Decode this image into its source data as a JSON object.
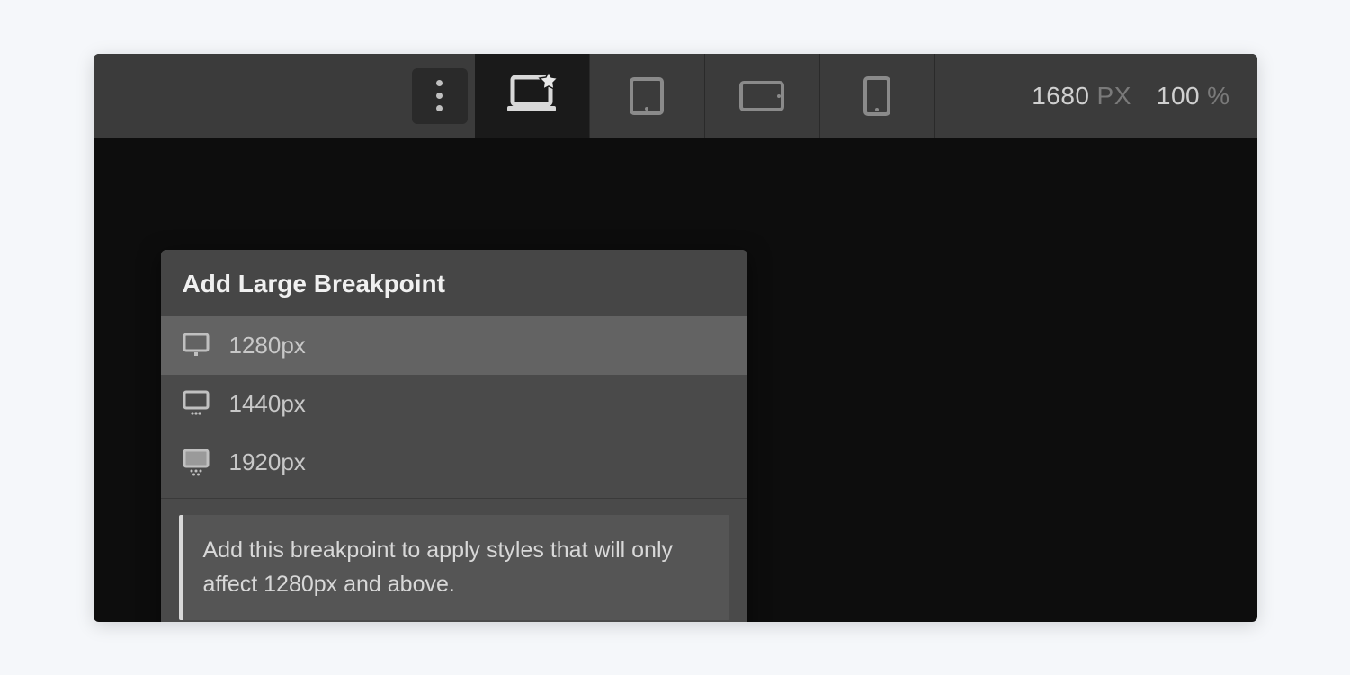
{
  "toolbar": {
    "width_value": "1680",
    "width_unit": "PX",
    "zoom_value": "100",
    "zoom_unit": "%"
  },
  "dropdown": {
    "title": "Add Large Breakpoint",
    "items": [
      {
        "label": "1280px"
      },
      {
        "label": "1440px"
      },
      {
        "label": "1920px"
      }
    ],
    "hint": "Add this breakpoint to apply styles that will only affect 1280px and above."
  }
}
